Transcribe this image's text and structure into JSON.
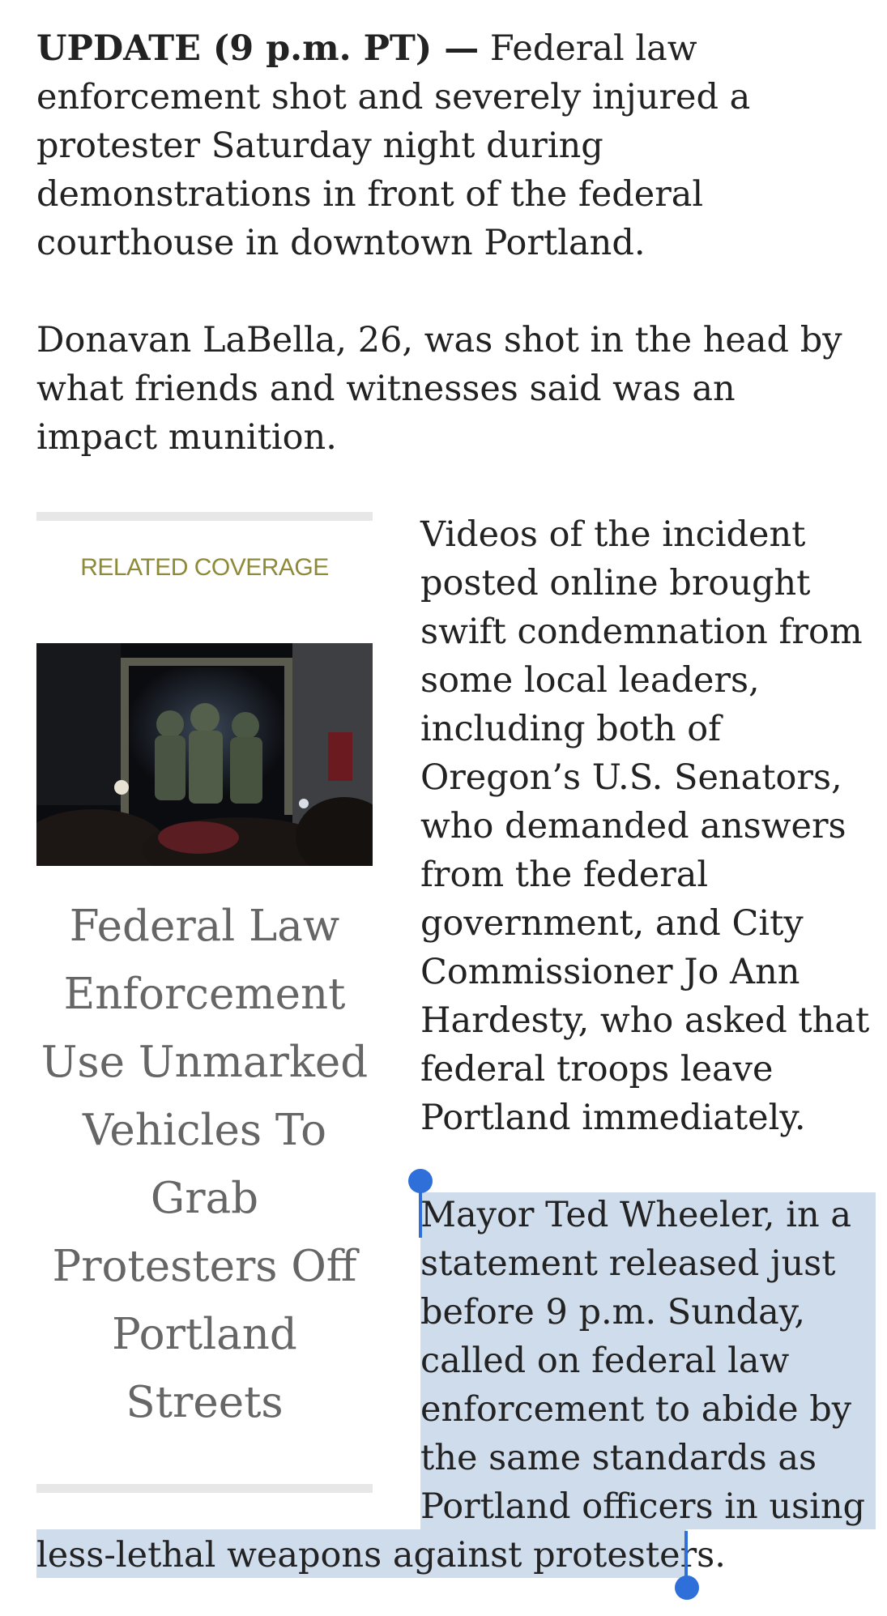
{
  "article": {
    "lead_strong": "UPDATE (9 p.m. PT) —",
    "lead_rest": " Federal law enforcement shot and severely injured a protester Saturday night during demonstrations in front of the federal courthouse in downtown Portland.",
    "paragraph_2": "Donavan LaBella, 26, was shot in the head by what friends and witnesses said was an impact munition.",
    "paragraph_3": "Videos of the incident posted online brought swift condemnation from some local leaders, including both of Oregon’s U.S. Senators, who demanded answers from the federal government, and City Commissioner Jo Ann Hardesty, who asked that federal troops leave Portland immediately.",
    "paragraph_4_wrapped": "Mayor Ted Wheeler, in a statement released just before 9 p.m. Sunday, called on federal law enforcement to abide by the same standards as Portland officers in using",
    "paragraph_4_tail": "less-lethal weapons against protesters."
  },
  "related": {
    "label": "RELATED COVERAGE",
    "image_icon": "photo-federal-officers-in-doorway",
    "title": "Federal Law Enforcement Use Unmarked Vehicles To Grab Protesters Off Portland Streets"
  },
  "selection": {
    "highlight_color": "#cfdcec",
    "handle_color": "#2f6fd9"
  },
  "colors": {
    "related_label": "#8f8a38",
    "related_title": "#666666",
    "body_text": "#222222"
  }
}
